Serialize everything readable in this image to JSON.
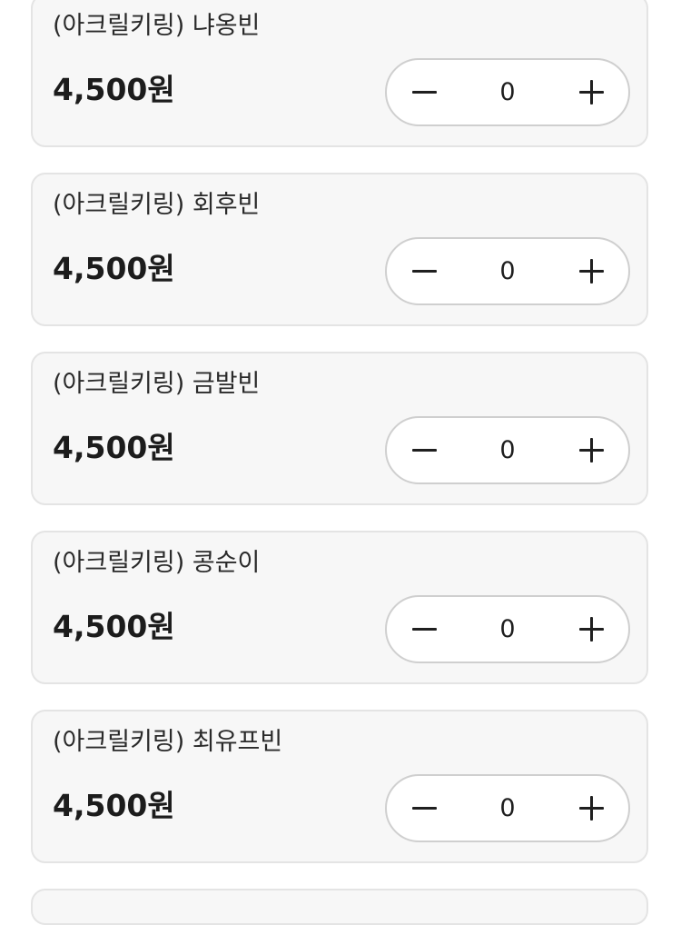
{
  "items": [
    {
      "name": "(아크릴키링) 냐옹빈",
      "price": "4,500원",
      "quantity": "0"
    },
    {
      "name": "(아크릴키링) 회후빈",
      "price": "4,500원",
      "quantity": "0"
    },
    {
      "name": "(아크릴키링) 금발빈",
      "price": "4,500원",
      "quantity": "0"
    },
    {
      "name": "(아크릴키링) 콩순이",
      "price": "4,500원",
      "quantity": "0"
    },
    {
      "name": "(아크릴키링) 최유프빈",
      "price": "4,500원",
      "quantity": "0"
    }
  ],
  "icons": {
    "decrease": "minus-icon",
    "increase": "plus-icon"
  }
}
